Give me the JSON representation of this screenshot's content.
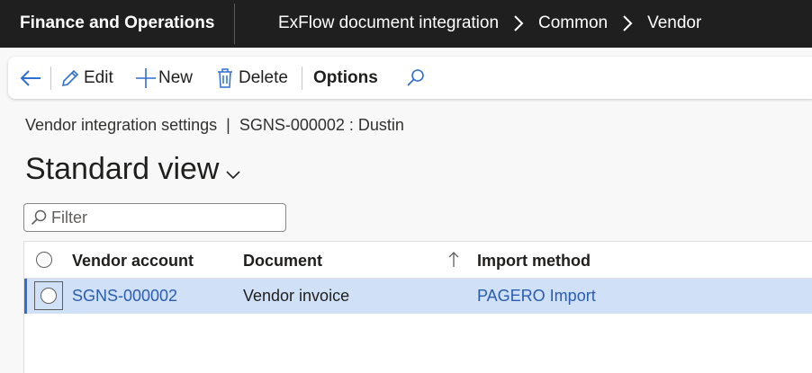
{
  "topbar": {
    "app_title": "Finance and Operations",
    "breadcrumbs": [
      "ExFlow document integration",
      "Common",
      "Vendor"
    ]
  },
  "toolbar": {
    "back_icon": "back-arrow-icon",
    "edit_label": "Edit",
    "new_label": "New",
    "delete_label": "Delete",
    "options_label": "Options",
    "search_icon": "search-icon"
  },
  "page": {
    "caption": "Vendor integration settings  |  SGNS-000002 : Dustin",
    "view_title": "Standard view"
  },
  "filter": {
    "placeholder": "Filter"
  },
  "grid": {
    "columns": [
      "Vendor account",
      "Document",
      "Import method"
    ],
    "sorted_column": "Document",
    "rows": [
      {
        "vendor_account": "SGNS-000002",
        "document": "Vendor invoice",
        "import_method": "PAGERO Import",
        "selected": true
      }
    ]
  },
  "colors": {
    "topbar_bg": "#1f1f1f",
    "accent": "#2f6fcf",
    "selected_row_bg": "#cfe0f7",
    "link": "#2a5db0"
  }
}
